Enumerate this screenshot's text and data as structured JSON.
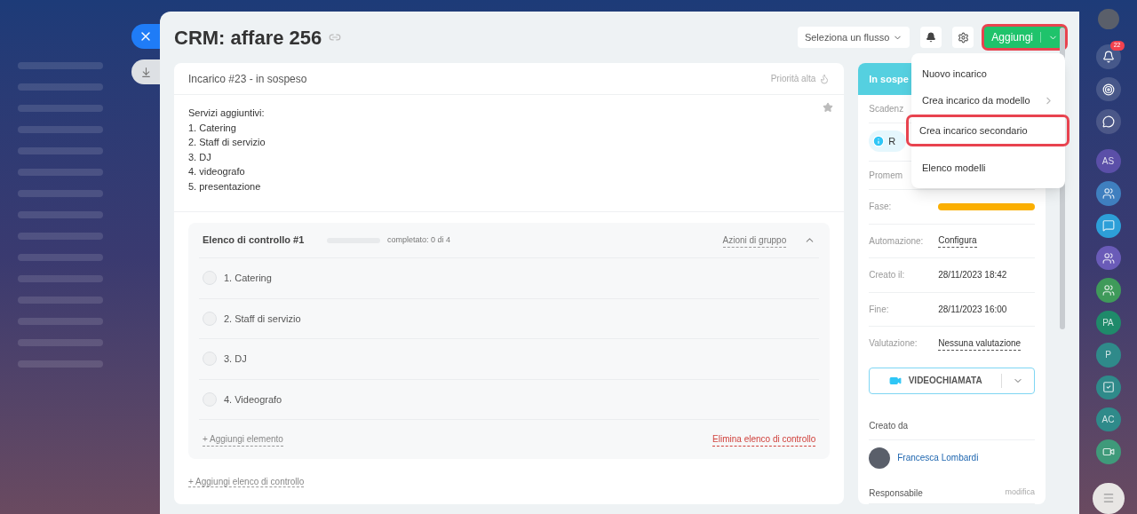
{
  "window": {
    "title": "CRM: affare 256"
  },
  "header": {
    "flow_select": "Seleziona un flusso",
    "add_button": {
      "label": "Aggiungi",
      "highlighted": true
    }
  },
  "add_menu": [
    {
      "label": "Nuovo incarico",
      "submenu": false,
      "highlighted": false
    },
    {
      "label": "Crea incarico da modello",
      "submenu": true,
      "highlighted": false
    },
    {
      "label": "Crea incarico secondario",
      "submenu": false,
      "highlighted": true
    },
    {
      "label": "Elenco modelli",
      "submenu": false,
      "highlighted": false
    }
  ],
  "task": {
    "title": "Incarico #23 - in sospeso",
    "priority": "Priorità alta",
    "description": [
      "Servizi aggiuntivi:",
      "1. Catering",
      "2. Staff di servizio",
      "3. DJ",
      "4. videografo",
      "5. presentazione"
    ],
    "checklist": {
      "title": "Elenco di controllo #1",
      "level": 0,
      "progress": "completato: 0 di 4",
      "group_actions": "Azioni di gruppo",
      "expanded": true,
      "items": [
        {
          "label": "1. Catering",
          "checked": false
        },
        {
          "label": "2. Staff di servizio",
          "checked": false
        },
        {
          "label": "3. DJ",
          "checked": false
        },
        {
          "label": "4. Videografo",
          "checked": false
        }
      ],
      "add_item": "+ Aggiungi elemento",
      "delete": "Elimina elenco di controllo"
    },
    "add_checklist": "+ Aggiungi elenco di controllo"
  },
  "side": {
    "status": "In sospe",
    "deadline_label": "Scadenz",
    "info": "R",
    "reminder_label": "Promem",
    "rows": [
      {
        "label": "Fase:",
        "kind": "stage"
      },
      {
        "label": "Automazione:",
        "kind": "link",
        "value": "Configura"
      },
      {
        "label": "Creato il:",
        "kind": "text",
        "value": "28/11/2023 18:42"
      },
      {
        "label": "Fine:",
        "kind": "text",
        "value": "28/11/2023 16:00"
      },
      {
        "label": "Valutazione:",
        "kind": "link",
        "value": "Nessuna valutazione"
      }
    ],
    "video_button": "VIDEOCHIAMATA",
    "created_by": "Creato da",
    "creator": "Francesca Lombardi",
    "responsible": "Responsabile",
    "edit": "modifica"
  },
  "rail": {
    "notifications": "22",
    "avatars": [
      {
        "initials": "AS",
        "color": "#5b4fa8"
      },
      {
        "kind": "group",
        "color": "#3f7fbf"
      },
      {
        "kind": "chat",
        "color": "#2d9fd8"
      },
      {
        "kind": "group",
        "color": "#6a5bb8"
      },
      {
        "kind": "group",
        "color": "#3f9a5a"
      },
      {
        "initials": "PA",
        "color": "#1f8a6a"
      },
      {
        "initials": "P",
        "color": "#2f8a8a"
      },
      {
        "kind": "task",
        "color": "#2f8a8a"
      },
      {
        "initials": "AC",
        "color": "#2f8a8a"
      },
      {
        "kind": "video",
        "color": "#3f9a7a"
      }
    ]
  }
}
